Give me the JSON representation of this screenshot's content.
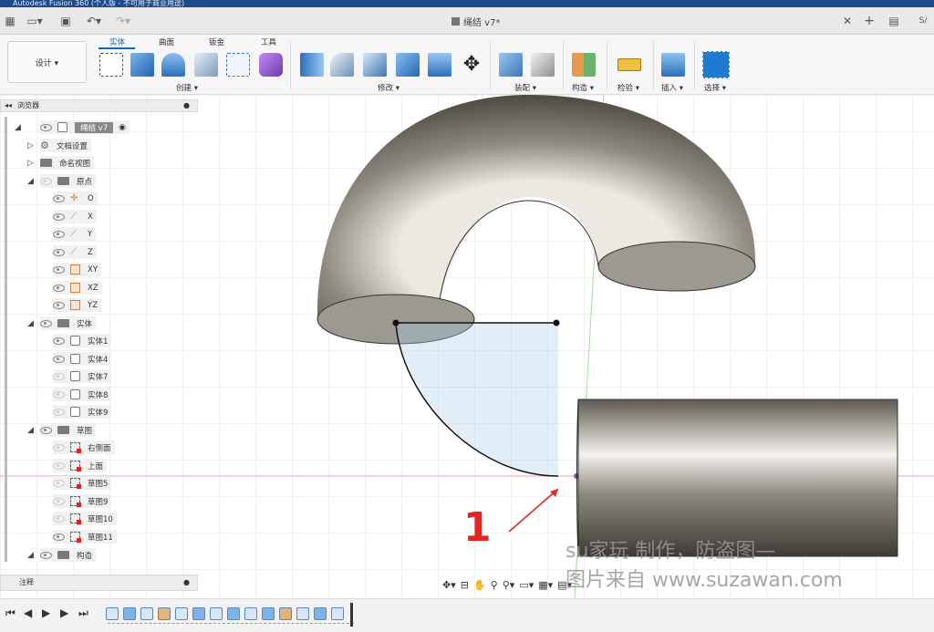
{
  "window": {
    "title": "Autodesk Fusion 360 (个人版 - 不可用于商业用途)"
  },
  "document": {
    "tab_title": "绳结 v7*"
  },
  "topbar": {
    "user_label": "S/"
  },
  "toolbar": {
    "design_label": "设计 ▾",
    "tabs": [
      "实体",
      "曲面",
      "钣金",
      "工具"
    ],
    "groups": [
      "创建 ▾",
      "修改 ▾",
      "装配 ▾",
      "构造 ▾",
      "检验 ▾",
      "插入 ▾",
      "选择 ▾"
    ]
  },
  "browser": {
    "header": "浏览器",
    "root": "绳结 v7",
    "items": {
      "doc_settings": "文档设置",
      "named_views": "命名视图",
      "origin": "原点",
      "o": "O",
      "x": "X",
      "y": "Y",
      "z": "Z",
      "xy": "XY",
      "xz": "XZ",
      "yz": "YZ",
      "bodies": "实体",
      "body1": "实体1",
      "body4": "实体4",
      "body7": "实体7",
      "body8": "实体8",
      "body9": "实体9",
      "sketches": "草图",
      "sk_right": "右侧面",
      "sk_top": "上面",
      "sk5": "草图5",
      "sk9": "草图9",
      "sk10": "草图10",
      "sk11": "草图11",
      "construction": "构造"
    }
  },
  "comments": {
    "label": "注释"
  },
  "annotation": {
    "number": "1"
  },
  "watermark": {
    "line1": "su家玩 制作，防盗图—",
    "line2": "图片来自 www.suzawan.com"
  },
  "colors": {
    "accent": "#0a6ab8",
    "annotation": "#e52521",
    "titlebar": "#1e4a8a"
  }
}
